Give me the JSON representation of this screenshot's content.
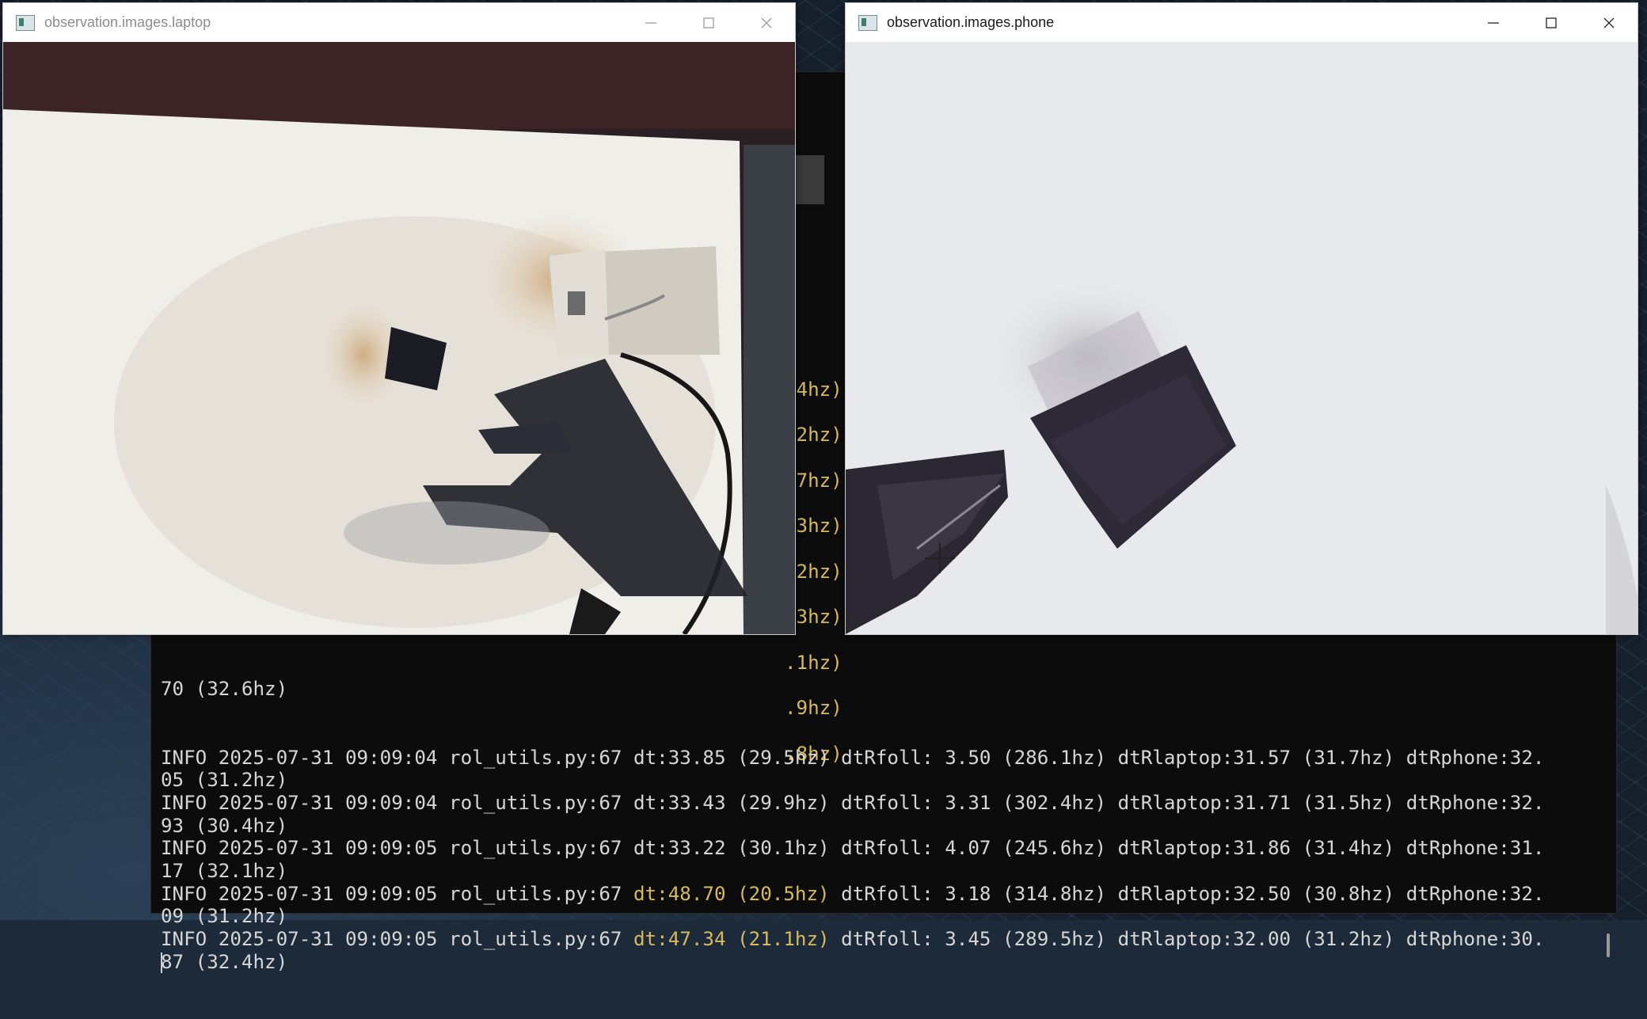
{
  "windows": {
    "laptop": {
      "title": "observation.images.laptop",
      "app_icon": "image-viewer-icon"
    },
    "phone": {
      "title": "observation.images.phone",
      "app_icon": "image-viewer-icon"
    },
    "controls": {
      "minimize": "minimize-icon",
      "maximize": "maximize-icon",
      "close": "close-icon"
    }
  },
  "terminal": {
    "side_fragments": [
      ".4hz)",
      ".2hz)",
      ".7hz)",
      ".3hz)",
      ".2hz)",
      ".3hz)",
      ".1hz)",
      ".9hz)",
      ".8hz)"
    ],
    "first_line_fragment": "70 (32.6hz)",
    "log": [
      {
        "prefix": "INFO 2025-07-31 09:09:04 rol_utils.py:67 ",
        "dt": "dt:33.85 (29.5hz)",
        "rest": " dtRfoll: 3.50 (286.1hz) dtRlaptop:31.57 (31.7hz) dtRphone:32.",
        "wrap": "05 (31.2hz)",
        "slow": false
      },
      {
        "prefix": "INFO 2025-07-31 09:09:04 rol_utils.py:67 ",
        "dt": "dt:33.43 (29.9hz)",
        "rest": " dtRfoll: 3.31 (302.4hz) dtRlaptop:31.71 (31.5hz) dtRphone:32.",
        "wrap": "93 (30.4hz)",
        "slow": false
      },
      {
        "prefix": "INFO 2025-07-31 09:09:05 rol_utils.py:67 ",
        "dt": "dt:33.22 (30.1hz)",
        "rest": " dtRfoll: 4.07 (245.6hz) dtRlaptop:31.86 (31.4hz) dtRphone:31.",
        "wrap": "17 (32.1hz)",
        "slow": false
      },
      {
        "prefix": "INFO 2025-07-31 09:09:05 rol_utils.py:67 ",
        "dt": "dt:48.70 (20.5hz)",
        "rest": " dtRfoll: 3.18 (314.8hz) dtRlaptop:32.50 (30.8hz) dtRphone:32.",
        "wrap": "09 (31.2hz)",
        "slow": true
      },
      {
        "prefix": "INFO 2025-07-31 09:09:05 rol_utils.py:67 ",
        "dt": "dt:47.34 (21.1hz)",
        "rest": " dtRfoll: 3.45 (289.5hz) dtRlaptop:32.00 (31.2hz) dtRphone:30.",
        "wrap": "87 (32.4hz)",
        "slow": true
      }
    ]
  }
}
